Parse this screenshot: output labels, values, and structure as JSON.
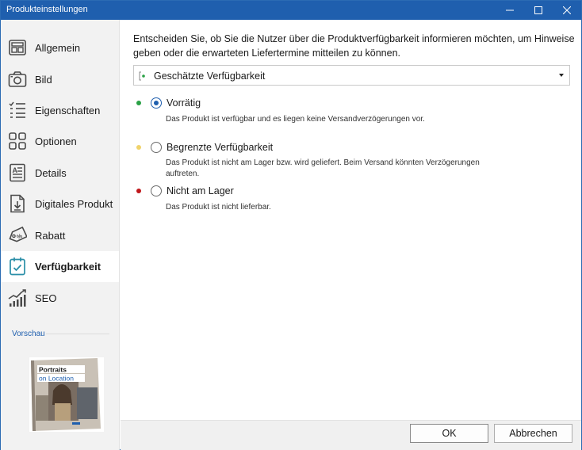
{
  "window": {
    "title": "Produkteinstellungen"
  },
  "sidebar": {
    "items": [
      {
        "label": "Allgemein",
        "icon": "layout-icon"
      },
      {
        "label": "Bild",
        "icon": "camera-icon"
      },
      {
        "label": "Eigenschaften",
        "icon": "list-icon"
      },
      {
        "label": "Optionen",
        "icon": "grid-icon"
      },
      {
        "label": "Details",
        "icon": "document-icon"
      },
      {
        "label": "Digitales Produkt",
        "icon": "download-file-icon"
      },
      {
        "label": "Rabatt",
        "icon": "tag-icon"
      },
      {
        "label": "Verfügbarkeit",
        "icon": "calendar-check-icon",
        "active": true
      },
      {
        "label": "SEO",
        "icon": "chart-icon"
      }
    ],
    "preview_label": "Vorschau",
    "preview_book": {
      "title_line1": "Portraits",
      "title_line2": "on Location"
    }
  },
  "main": {
    "intro": "Entscheiden Sie, ob Sie die Nutzer über die Produktverfügbarkeit informieren möchten, um Hinweise geben oder die erwarteten Liefertermine mitteilen zu können.",
    "select_value": "Geschätzte Verfügbarkeit",
    "options": [
      {
        "label": "Vorrätig",
        "description": "Das Produkt ist verfügbar und es liegen keine Versandverzögerungen vor.",
        "dot_color": "#2aa146",
        "checked": true
      },
      {
        "label": "Begrenzte Verfügbarkeit",
        "description": "Das Produkt ist nicht am Lager bzw. wird geliefert. Beim Versand könnten Verzögerungen auftreten.",
        "dot_color": "#f0d36b",
        "checked": false
      },
      {
        "label": "Nicht am Lager",
        "description": "Das Produkt ist nicht lieferbar.",
        "dot_color": "#c0171b",
        "checked": false
      }
    ]
  },
  "footer": {
    "ok_label": "OK",
    "cancel_label": "Abbrechen"
  },
  "colors": {
    "accent": "#1f5fae",
    "icon": "#4a4a4a",
    "active_icon": "#2b8fa8"
  }
}
